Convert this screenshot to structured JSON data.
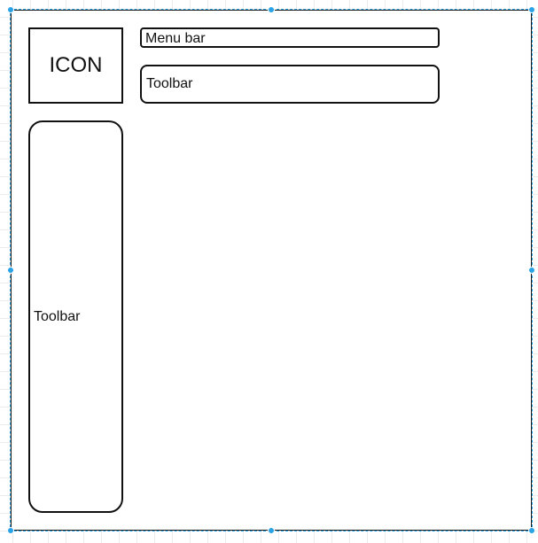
{
  "wireframe": {
    "icon_label": "ICON",
    "menu_bar_label": "Menu bar",
    "top_toolbar_label": "Toolbar",
    "side_toolbar_label": "Toolbar"
  },
  "colors": {
    "outline": "#111111",
    "selection": "#29a3e6",
    "grid": "#ececec"
  }
}
